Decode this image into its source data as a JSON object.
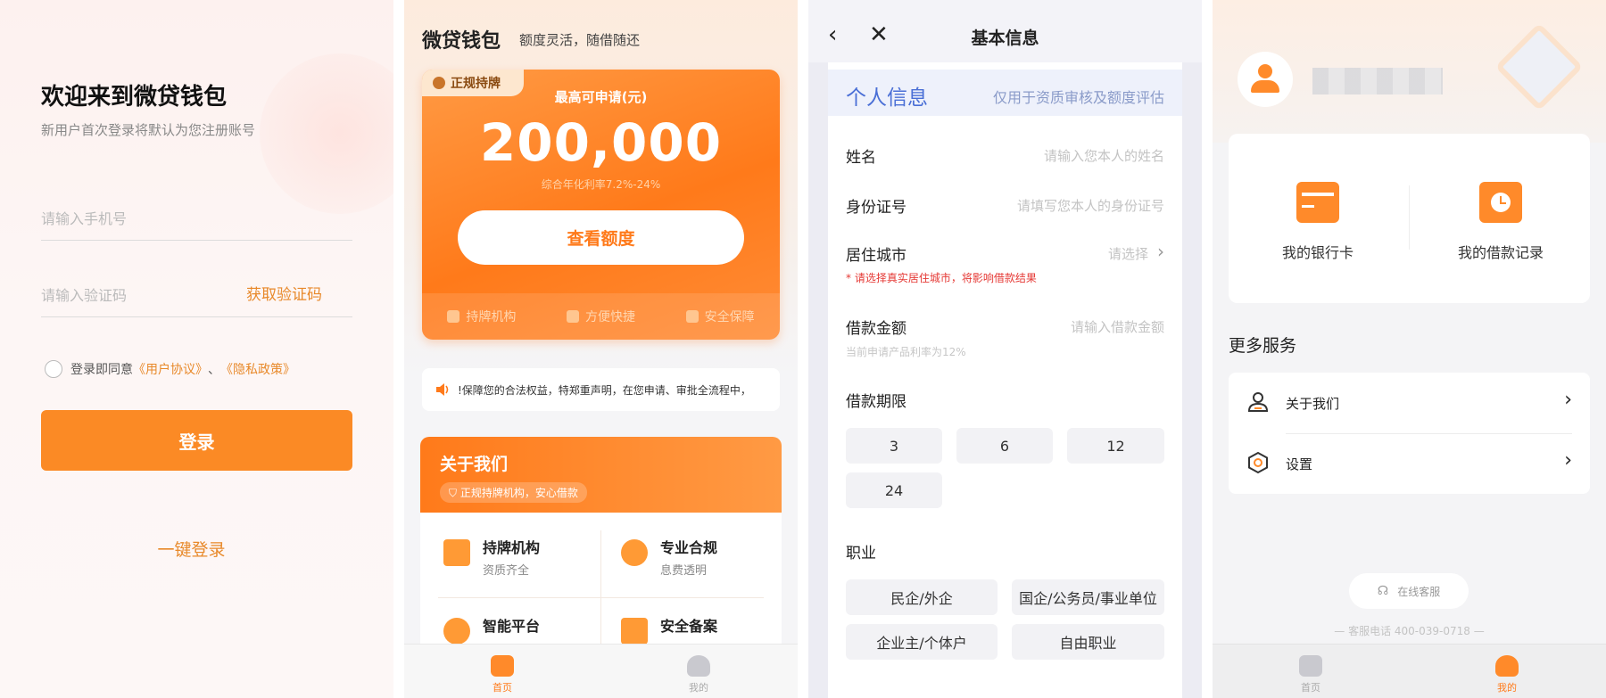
{
  "login": {
    "title": "欢迎来到微贷钱包",
    "subtitle": "新用户首次登录将默认为您注册账号",
    "phone_placeholder": "请输入手机号",
    "code_placeholder": "请输入验证码",
    "get_code": "获取验证码",
    "agree_prefix": "登录即同意",
    "agreement_user": "《用户协议》",
    "agreement_sep": "、",
    "agreement_privacy": "《隐私政策》",
    "login_button": "登录",
    "quick_login": "一键登录"
  },
  "home": {
    "brand": "微贷钱包",
    "slogan": "额度灵活，随借随还",
    "badge": "正规持牌",
    "max_label": "最高可申请(元)",
    "amount": "200,000",
    "rate": "综合年化利率7.2%-24%",
    "view_button": "查看额度",
    "features": [
      "持牌机构",
      "方便快捷",
      "安全保障"
    ],
    "notice": "!保障您的合法权益，特郑重声明，在您申请、审批全流程中，",
    "about_title": "关于我们",
    "about_sub": "正规持牌机构，安心借款",
    "about_items": [
      {
        "title": "持牌机构",
        "sub": "资质齐全"
      },
      {
        "title": "专业合规",
        "sub": "息费透明"
      },
      {
        "title": "智能平台",
        "sub": ""
      },
      {
        "title": "安全备案",
        "sub": ""
      }
    ],
    "tabs": {
      "home": "首页",
      "mine": "我的"
    },
    "colors": {
      "accent": "#ff7a1a",
      "text": "#222222"
    }
  },
  "basic": {
    "back": "‹",
    "close": "✕",
    "title": "基本信息",
    "section_title": "个人信息",
    "section_note": "仅用于资质审核及额度评估",
    "name_label": "姓名",
    "name_ph": "请输入您本人的姓名",
    "id_label": "身份证号",
    "id_ph": "请填写您本人的身份证号",
    "city_label": "居住城市",
    "city_ph": "请选择",
    "city_warn": "* 请选择真实居住城市，将影响借款结果",
    "amount_label": "借款金额",
    "amount_ph": "请输入借款金额",
    "amount_hint": "当前申请产品利率为12%",
    "term_label": "借款期限",
    "terms": [
      "3",
      "6",
      "12",
      "24"
    ],
    "job_label": "职业",
    "jobs": [
      "民企/外企",
      "国企/公务员/事业单位",
      "企业主/个体户",
      "自由职业"
    ]
  },
  "mine": {
    "bank_card": "我的银行卡",
    "loan_record": "我的借款记录",
    "more_services": "更多服务",
    "about_us": "关于我们",
    "settings": "设置",
    "online_service": "在线客服",
    "phone": "— 客服电话 400-039-0718 —",
    "tabs": {
      "home": "首页",
      "mine": "我的"
    }
  }
}
